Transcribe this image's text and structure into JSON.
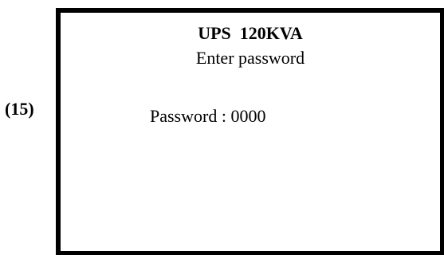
{
  "step": {
    "label": "(15)"
  },
  "screen": {
    "title": "UPS  120KVA",
    "subtitle": "Enter password",
    "password": {
      "label": "Password",
      "separator": " : ",
      "value": "0000"
    }
  }
}
